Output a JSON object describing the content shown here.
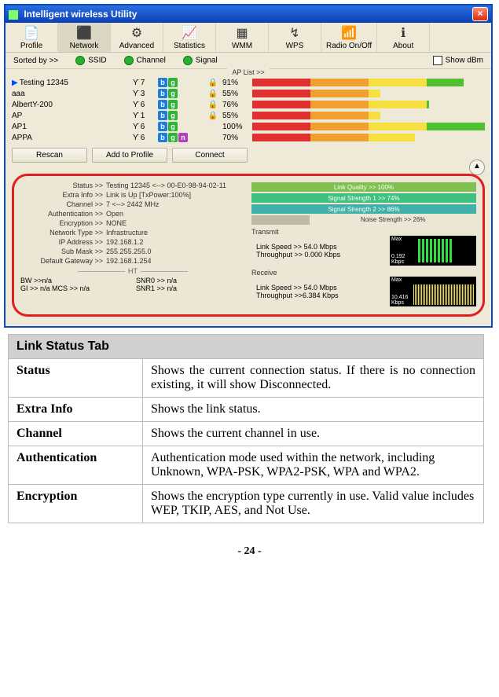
{
  "window": {
    "title": "Intelligent wireless Utility",
    "close_label": "×"
  },
  "toolbar": {
    "items": [
      {
        "icon": "📄",
        "label": "Profile"
      },
      {
        "icon": "⬛",
        "label": "Network"
      },
      {
        "icon": "⚙",
        "label": "Advanced"
      },
      {
        "icon": "📈",
        "label": "Statistics"
      },
      {
        "icon": "▦",
        "label": "WMM"
      },
      {
        "icon": "↯",
        "label": "WPS"
      },
      {
        "icon": "📶",
        "label": "Radio On/Off"
      },
      {
        "icon": "ℹ",
        "label": "About"
      }
    ]
  },
  "sortbar": {
    "sorted_by": "Sorted by >>",
    "opt_ssid": "SSID",
    "opt_channel": "Channel",
    "opt_signal": "Signal",
    "show_dbm": "Show dBm"
  },
  "aplist_label": "AP List >>",
  "aplist": [
    {
      "name": "Testing 12345",
      "arrow": true,
      "ant": "7",
      "bands": [
        "b",
        "g"
      ],
      "lock": true,
      "pct": "91%",
      "fill": 91
    },
    {
      "name": "aaa",
      "ant": "3",
      "bands": [
        "b",
        "g"
      ],
      "lock": true,
      "pct": "55%",
      "fill": 55
    },
    {
      "name": "AlbertY-200",
      "ant": "6",
      "bands": [
        "b",
        "g"
      ],
      "lock": true,
      "pct": "76%",
      "fill": 76
    },
    {
      "name": "AP",
      "ant": "1",
      "bands": [
        "b",
        "g"
      ],
      "lock": true,
      "pct": "55%",
      "fill": 55
    },
    {
      "name": "AP1",
      "ant": "6",
      "bands": [
        "b",
        "g"
      ],
      "lock": false,
      "pct": "100%",
      "fill": 100
    },
    {
      "name": "APPA",
      "ant": "6",
      "bands": [
        "b",
        "g",
        "n"
      ],
      "lock": false,
      "pct": "70%",
      "fill": 70
    }
  ],
  "buttons": {
    "rescan": "Rescan",
    "add_profile": "Add to Profile",
    "connect": "Connect"
  },
  "status_panel": {
    "rows": [
      {
        "k": "Status >>",
        "v": "Testing 12345 <--> 00-E0-98-94-02-11"
      },
      {
        "k": "Extra Info >>",
        "v": "Link is Up [TxPower:100%]"
      },
      {
        "k": "Channel >>",
        "v": "7 <--> 2442 MHz"
      },
      {
        "k": "Authentication >>",
        "v": "Open"
      },
      {
        "k": "Encryption >>",
        "v": "NONE"
      },
      {
        "k": "Network Type >>",
        "v": "Infrastructure"
      },
      {
        "k": "IP Address >>",
        "v": "192.168.1.2"
      },
      {
        "k": "Sub Mask >>",
        "v": "255.255.255.0"
      },
      {
        "k": "Default Gateway >>",
        "v": "192.168.1.254"
      }
    ],
    "ht_label": "HT",
    "ht_rows": [
      {
        "a": "BW >>n/a",
        "b": "SNR0 >>  n/a"
      },
      {
        "a": "GI >> n/a        MCS >>  n/a",
        "b": "SNR1 >>  n/a"
      }
    ],
    "meters": {
      "lq": "Link Quality >> 100%",
      "ss1": "Signal Strength 1 >> 74%",
      "ss2": "Signal Strength 2 >> 86%",
      "ns": "Noise Strength >> 26%"
    },
    "transmit": {
      "title": "Transmit",
      "link_speed": "Link Speed >> 54.0 Mbps",
      "throughput": "Throughput >> 0.000 Kbps",
      "graph_max": "Max",
      "graph_val": "0.192\nKbps"
    },
    "receive": {
      "title": "Receive",
      "link_speed": "Link Speed >> 54.0 Mbps",
      "throughput": "Throughput >>6.384 Kbps",
      "graph_max": "Max",
      "graph_val": "10.416\nKbps"
    }
  },
  "desc_table": {
    "header": "Link Status Tab",
    "rows": [
      {
        "k": "Status",
        "v": "Shows the current connection status. If there is no connection existing, it will show Disconnected.",
        "justify": true
      },
      {
        "k": "Extra Info",
        "v": "Shows the link status."
      },
      {
        "k": "Channel",
        "v": "Shows the current channel in use."
      },
      {
        "k": "Authentication",
        "v": "Authentication mode used within the network, including Unknown, WPA-PSK, WPA2-PSK, WPA and WPA2."
      },
      {
        "k": "Encryption",
        "v": "Shows the encryption type currently in use. Valid value includes WEP, TKIP, AES, and Not Use."
      }
    ]
  },
  "page_number": "- 24 -"
}
